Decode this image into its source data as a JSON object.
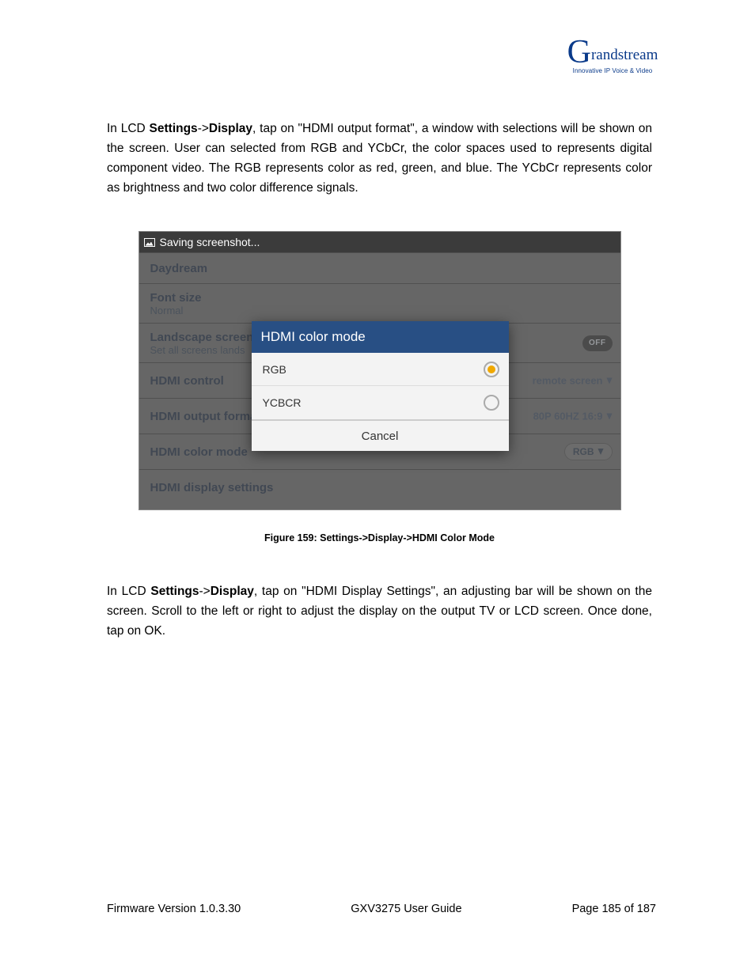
{
  "logo": {
    "brand_prefix": "G",
    "brand_rest": "randstream",
    "tagline": "Innovative IP Voice & Video"
  },
  "para1": {
    "pre": "In LCD ",
    "b1": "Settings",
    "sep": "->",
    "b2": "Display",
    "post": ", tap on \"HDMI output format\", a window with selections will be shown on the screen. User can selected from RGB and YCbCr, the color spaces used to represents digital component video. The RGB represents color as red, green, and blue. The YCbCr represents color as brightness and two color difference signals."
  },
  "screenshot": {
    "status_text": "Saving screenshot...",
    "rows": {
      "daydream": "Daydream",
      "font_size_title": "Font size",
      "font_size_value": "Normal",
      "landscape_title": "Landscape screen",
      "landscape_sub": "Set all screens lands",
      "landscape_badge": "OFF",
      "hdmi_control": "HDMI control",
      "hdmi_control_right": "remote screen",
      "hdmi_output_format": "HDMI output forma",
      "hdmi_output_right": "80P 60HZ 16:9",
      "hdmi_color_mode": "HDMI color mode",
      "hdmi_color_right": "RGB",
      "hdmi_display_settings": "HDMI display settings"
    },
    "dialog": {
      "title": "HDMI color mode",
      "option1": "RGB",
      "option2": "YCBCR",
      "cancel": "Cancel"
    }
  },
  "caption": "Figure 159: Settings->Display->HDMI Color Mode",
  "para2": {
    "pre": "In LCD ",
    "b1": "Settings",
    "sep": "->",
    "b2": "Display",
    "post": ", tap on \"HDMI Display Settings\", an adjusting bar will be shown on the screen. Scroll to the left or right to adjust the display on the output TV or LCD screen. Once done, tap on OK."
  },
  "footer": {
    "left": "Firmware Version 1.0.3.30",
    "center": "GXV3275 User Guide",
    "right": "Page 185 of 187"
  }
}
